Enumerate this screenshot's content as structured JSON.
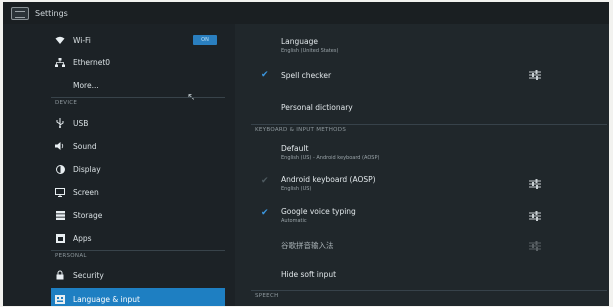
{
  "app": {
    "title": "Settings"
  },
  "sidebar": {
    "wifi_toggle": "ON",
    "items": [
      {
        "label": "Wi-Fi",
        "icon": "wifi-icon"
      },
      {
        "label": "Ethernet0",
        "icon": "ethernet-icon"
      },
      {
        "label": "More...",
        "icon": ""
      },
      {
        "label": "USB",
        "icon": "usb-icon"
      },
      {
        "label": "Sound",
        "icon": "sound-icon"
      },
      {
        "label": "Display",
        "icon": "display-icon"
      },
      {
        "label": "Screen",
        "icon": "screen-icon"
      },
      {
        "label": "Storage",
        "icon": "storage-icon"
      },
      {
        "label": "Apps",
        "icon": "apps-icon"
      },
      {
        "label": "Security",
        "icon": "lock-icon"
      },
      {
        "label": "Language & input",
        "icon": "keyboard-icon"
      }
    ],
    "sections": {
      "device": "DEVICE",
      "personal": "PERSONAL"
    }
  },
  "content": {
    "language": {
      "title": "Language",
      "summary": "English (United States)"
    },
    "spell_checker": {
      "title": "Spell checker"
    },
    "personal_dictionary": {
      "title": "Personal dictionary"
    },
    "section_keyboard": "KEYBOARD & INPUT METHODS",
    "default": {
      "title": "Default",
      "summary": "English (US) - Android keyboard (AOSP)"
    },
    "android_keyboard": {
      "title": "Android keyboard (AOSP)",
      "summary": "English (US)"
    },
    "google_voice": {
      "title": "Google voice typing",
      "summary": "Automatic"
    },
    "pinyin": {
      "title": "谷歌拼音输入法"
    },
    "hide_soft_input": {
      "title": "Hide soft input"
    },
    "section_speech": "SPEECH"
  },
  "colors": {
    "accent": "#1e7fc2",
    "check": "#3b97e0",
    "background": "#1d2327"
  }
}
